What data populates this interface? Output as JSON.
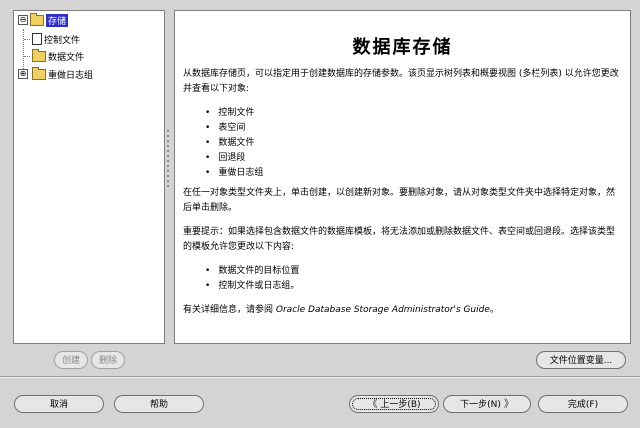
{
  "tree": {
    "root": {
      "label": "存储",
      "toggle": "⊖"
    },
    "items": [
      {
        "label": "控制文件",
        "icon": "document-icon"
      },
      {
        "label": "数据文件",
        "icon": "folder-icon"
      },
      {
        "label": "重做日志组",
        "icon": "folder-icon",
        "toggle": "⊕"
      }
    ]
  },
  "content": {
    "title": "数据库存储",
    "intro": "从数据库存储页，可以指定用于创建数据库的存储参数。该页显示树列表和概要视图 (多栏列表) 以允许您更改并查看以下对象:",
    "objects": [
      "控制文件",
      "表空间",
      "数据文件",
      "回退段",
      "重做日志组"
    ],
    "para2": "在任一对象类型文件夹上，单击创建，以创建新对象。要删除对象，请从对象类型文件夹中选择特定对象，然后单击删除。",
    "para3": "重要提示：如果选择包含数据文件的数据库模板，将无法添加或删除数据文件、表空间或回退段。选择该类型的模板允许您更改以下内容:",
    "changeable": [
      "数据文件的目标位置",
      "控制文件或日志组。"
    ],
    "para4_prefix": "有关详细信息，请参阅",
    "guide": "Oracle Database Storage Administrator's Guide",
    "para4_suffix": "。"
  },
  "buttons": {
    "create": "创建",
    "delete": "删除",
    "file_location": "文件位置变量...",
    "cancel": "取消",
    "help": "帮助",
    "back": "上一步(B)",
    "next": "下一步(N)",
    "finish": "完成(F)",
    "back_icon": "《",
    "next_icon": "》"
  }
}
